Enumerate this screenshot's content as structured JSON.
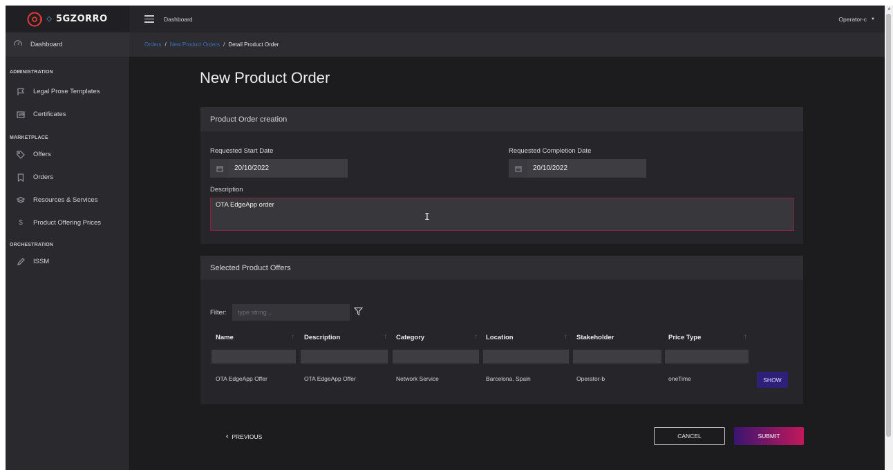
{
  "brand": {
    "name": "5GZORRO"
  },
  "header": {
    "title": "Dashboard",
    "user": "Operator-c"
  },
  "breadcrumb": {
    "items": [
      "Orders",
      "New Product Orders"
    ],
    "current": "Detail Product Order"
  },
  "sidebar": {
    "dashboard": "Dashboard",
    "sections": [
      {
        "title": "ADMINISTRATION",
        "items": [
          {
            "label": "Legal Prose Templates",
            "icon": "flag-icon"
          },
          {
            "label": "Certificates",
            "icon": "certificate-icon"
          }
        ]
      },
      {
        "title": "MARKETPLACE",
        "items": [
          {
            "label": "Offers",
            "icon": "tag-icon"
          },
          {
            "label": "Orders",
            "icon": "bookmark-icon"
          },
          {
            "label": "Resources & Services",
            "icon": "layers-icon"
          },
          {
            "label": "Product Offering Prices",
            "icon": "dollar-icon"
          }
        ]
      },
      {
        "title": "ORCHESTRATION",
        "items": [
          {
            "label": "ISSM",
            "icon": "pen-icon"
          }
        ]
      }
    ]
  },
  "page": {
    "title": "New Product Order"
  },
  "order_form": {
    "header": "Product Order creation",
    "start_label": "Requested Start Date",
    "start_value": "20/10/2022",
    "completion_label": "Requested Completion Date",
    "completion_value": "20/10/2022",
    "description_label": "Description",
    "description_value": "OTA EdgeApp order"
  },
  "offers": {
    "header": "Selected Product Offers",
    "filter_label": "Filter:",
    "filter_placeholder": "type string...",
    "columns": [
      "Name",
      "Description",
      "Category",
      "Location",
      "Stakeholder",
      "Price Type"
    ],
    "rows": [
      {
        "name": "OTA EdgeApp Offer",
        "description": "OTA EdgeApp Offer",
        "category": "Network Service",
        "location": "Barcelona, Spain",
        "stakeholder": "Operator-b",
        "price_type": "oneTime",
        "action": "SHOW"
      }
    ]
  },
  "footer": {
    "previous": "PREVIOUS",
    "cancel": "CANCEL",
    "submit": "SUBMIT"
  },
  "colors": {
    "accent_start": "#3a1570",
    "accent_end": "#c2185b",
    "show_button": "#2e1f7a",
    "link": "#3b6fb6"
  }
}
